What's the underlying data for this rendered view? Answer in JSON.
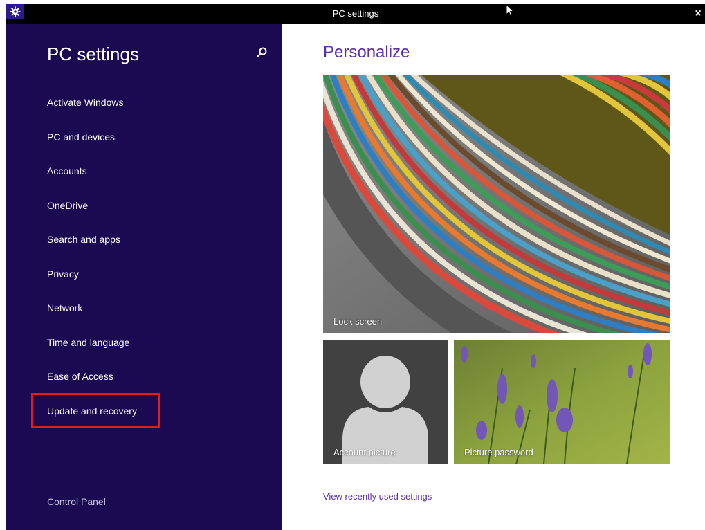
{
  "window": {
    "title": "PC settings",
    "close_glyph": "×",
    "icon": "gear-icon",
    "colors": {
      "titlebar": "#000000",
      "icon_bg": "#2b1a8e"
    }
  },
  "sidebar": {
    "title": "PC settings",
    "search_icon": "search-icon",
    "items": [
      {
        "label": "Activate Windows"
      },
      {
        "label": "PC and devices"
      },
      {
        "label": "Accounts"
      },
      {
        "label": "OneDrive"
      },
      {
        "label": "Search and apps"
      },
      {
        "label": "Privacy"
      },
      {
        "label": "Network"
      },
      {
        "label": "Time and language"
      },
      {
        "label": "Ease of Access"
      },
      {
        "label": "Update and recovery"
      }
    ],
    "highlighted_item": "Update and recovery",
    "footer_link": "Control Panel",
    "colors": {
      "background": "#1b0a52",
      "highlight_border": "#e21b22"
    }
  },
  "main": {
    "heading": "Personalize",
    "tiles": {
      "lock_screen": {
        "label": "Lock screen"
      },
      "account_picture": {
        "label": "Account picture"
      },
      "picture_password": {
        "label": "Picture password"
      }
    },
    "recent_settings_link": "View recently used settings",
    "colors": {
      "accent": "#5b2da8"
    }
  }
}
